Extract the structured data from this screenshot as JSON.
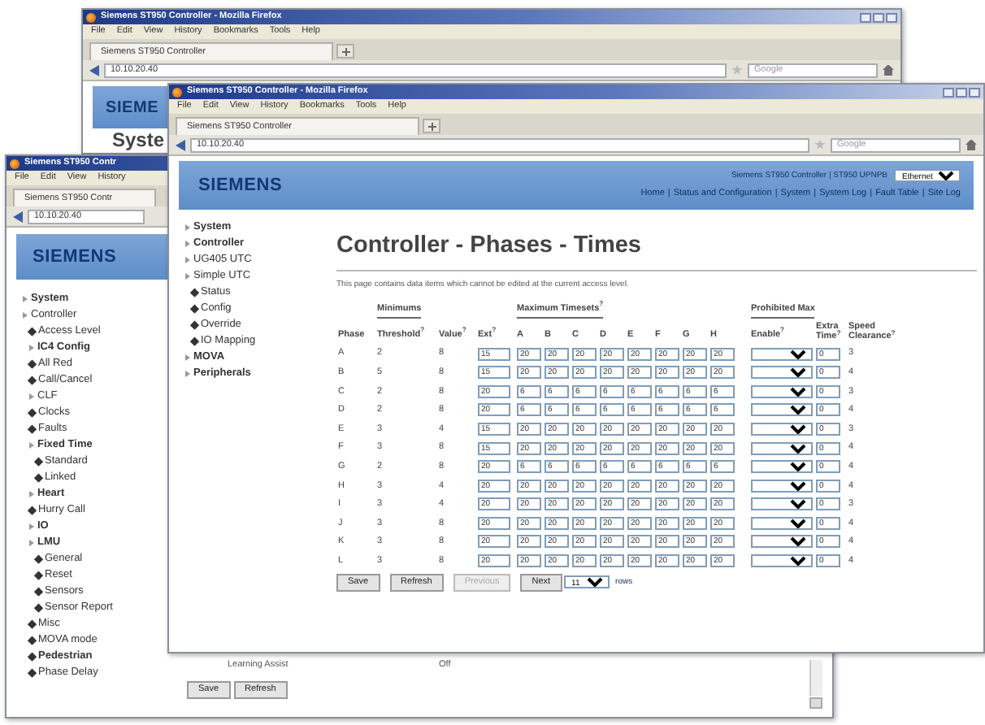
{
  "back_window": {
    "title": "Siemens ST950 Controller - Mozilla Firefox",
    "menu": [
      "File",
      "Edit",
      "View",
      "History",
      "Bookmarks",
      "Tools",
      "Help"
    ],
    "tab": "Siemens ST950 Controller",
    "address": "10.10.20.40",
    "search_placeholder": "Google",
    "logo": "SIEME",
    "heading": "Syste"
  },
  "main_window": {
    "title": "Siemens ST950 Controller - Mozilla Firefox",
    "menu": [
      "File",
      "Edit",
      "View",
      "History",
      "Bookmarks",
      "Tools",
      "Help"
    ],
    "tab": "Siemens ST950 Controller",
    "address": "10.10.20.40",
    "search_placeholder": "Google",
    "header": {
      "logo": "SIEMENS",
      "controller": "Siemens ST950 Controller | ST950 UPNPB",
      "mode_select": "Ethernet",
      "nav": [
        "Home",
        "Status and Configuration",
        "System",
        "System Log",
        "Fault Table",
        "Site Log"
      ],
      "nav_separator": "|"
    },
    "sidebar": [
      {
        "label": "System",
        "kind": "folder",
        "bold": true
      },
      {
        "label": "Controller",
        "kind": "folder",
        "bold": true
      },
      {
        "label": "UG405 UTC",
        "kind": "folder",
        "bold": false
      },
      {
        "label": "Simple UTC",
        "kind": "folder",
        "bold": false,
        "children": [
          {
            "label": "Status",
            "kind": "page",
            "bold": false
          },
          {
            "label": "Config",
            "kind": "page",
            "bold": false
          },
          {
            "label": "Override",
            "kind": "page",
            "bold": false
          },
          {
            "label": "IO Mapping",
            "kind": "page",
            "bold": false
          }
        ]
      },
      {
        "label": "MOVA",
        "kind": "folder",
        "bold": true
      },
      {
        "label": "Peripherals",
        "kind": "folder",
        "bold": true
      }
    ],
    "page": {
      "heading": "Controller - Phases - Times",
      "note": "This page contains data items which cannot be edited at the current access level.",
      "groups": {
        "minimums": "Minimums",
        "maximums": "Maximum Timesets$^{?}$",
        "prohibited": "Prohibited Max"
      },
      "columns": {
        "phase": "Phase",
        "threshold": "Threshold$^{?}$",
        "value": "Value$^{?}$",
        "ext": "Ext$^{?}$",
        "timesets": [
          "A",
          "B",
          "C",
          "D",
          "E",
          "F",
          "G",
          "H"
        ],
        "enable": "Enable$^{?}$",
        "extra_time": "Extra Time$^{?}$",
        "speed_clearance": "Speed Clearance$^{?}$"
      },
      "rows": [
        {
          "phase": "A",
          "threshold": "2",
          "value": "8",
          "ext": "15",
          "maximums": [
            "20",
            "20",
            "20",
            "20",
            "20",
            "20",
            "20",
            "20"
          ],
          "extra_time": "0",
          "speed_clearance": "3"
        },
        {
          "phase": "B",
          "threshold": "5",
          "value": "8",
          "ext": "15",
          "maximums": [
            "20",
            "20",
            "20",
            "20",
            "20",
            "20",
            "20",
            "20"
          ],
          "extra_time": "0",
          "speed_clearance": "4"
        },
        {
          "phase": "C",
          "threshold": "2",
          "value": "8",
          "ext": "20",
          "maximums": [
            "6",
            "6",
            "6",
            "6",
            "6",
            "6",
            "6",
            "6"
          ],
          "extra_time": "0",
          "speed_clearance": "3"
        },
        {
          "phase": "D",
          "threshold": "2",
          "value": "8",
          "ext": "20",
          "maximums": [
            "6",
            "6",
            "6",
            "6",
            "6",
            "6",
            "6",
            "6"
          ],
          "extra_time": "0",
          "speed_clearance": "4"
        },
        {
          "phase": "E",
          "threshold": "3",
          "value": "4",
          "ext": "15",
          "maximums": [
            "20",
            "20",
            "20",
            "20",
            "20",
            "20",
            "20",
            "20"
          ],
          "extra_time": "0",
          "speed_clearance": "3"
        },
        {
          "phase": "F",
          "threshold": "3",
          "value": "8",
          "ext": "15",
          "maximums": [
            "20",
            "20",
            "20",
            "20",
            "20",
            "20",
            "20",
            "20"
          ],
          "extra_time": "0",
          "speed_clearance": "4"
        },
        {
          "phase": "G",
          "threshold": "2",
          "value": "8",
          "ext": "20",
          "maximums": [
            "6",
            "6",
            "6",
            "6",
            "6",
            "6",
            "6",
            "6"
          ],
          "extra_time": "0",
          "speed_clearance": "4"
        },
        {
          "phase": "H",
          "threshold": "3",
          "value": "4",
          "ext": "20",
          "maximums": [
            "20",
            "20",
            "20",
            "20",
            "20",
            "20",
            "20",
            "20"
          ],
          "extra_time": "0",
          "speed_clearance": "4"
        },
        {
          "phase": "I",
          "threshold": "3",
          "value": "4",
          "ext": "20",
          "maximums": [
            "20",
            "20",
            "20",
            "20",
            "20",
            "20",
            "20",
            "20"
          ],
          "extra_time": "0",
          "speed_clearance": "3"
        },
        {
          "phase": "J",
          "threshold": "3",
          "value": "8",
          "ext": "20",
          "maximums": [
            "20",
            "20",
            "20",
            "20",
            "20",
            "20",
            "20",
            "20"
          ],
          "extra_time": "0",
          "speed_clearance": "4"
        },
        {
          "phase": "K",
          "threshold": "3",
          "value": "8",
          "ext": "20",
          "maximums": [
            "20",
            "20",
            "20",
            "20",
            "20",
            "20",
            "20",
            "20"
          ],
          "extra_time": "0",
          "speed_clearance": "4"
        },
        {
          "phase": "L",
          "threshold": "3",
          "value": "8",
          "ext": "20",
          "maximums": [
            "20",
            "20",
            "20",
            "20",
            "20",
            "20",
            "20",
            "20"
          ],
          "extra_time": "0",
          "speed_clearance": "4"
        }
      ],
      "buttons": [
        {
          "label": "Save",
          "disabled": false
        },
        {
          "label": "Refresh",
          "disabled": false
        },
        {
          "label": "Previous",
          "disabled": true
        },
        {
          "label": "Next",
          "disabled": false
        }
      ],
      "rows_select": "11",
      "rows_label": "rows"
    }
  },
  "left_window": {
    "title": "Siemens ST950 Contr",
    "menu": [
      "File",
      "Edit",
      "View",
      "History"
    ],
    "tab": "Siemens ST950 Contr",
    "address": "10.10.20.40",
    "logo": "SIEMENS",
    "sidebar": [
      {
        "label": "System",
        "kind": "folder",
        "bold": true
      },
      {
        "label": "Controller",
        "kind": "folder",
        "bold": false,
        "children": [
          {
            "label": "Access Level",
            "kind": "page",
            "bold": false
          },
          {
            "label": "IC4 Config",
            "kind": "folder",
            "bold": true
          },
          {
            "label": "All Red",
            "kind": "page",
            "bold": false
          },
          {
            "label": "Call/Cancel",
            "kind": "page",
            "bold": false
          },
          {
            "label": "CLF",
            "kind": "folder",
            "bold": false
          },
          {
            "label": "Clocks",
            "kind": "page",
            "bold": false
          },
          {
            "label": "Faults",
            "kind": "page",
            "bold": false
          },
          {
            "label": "Fixed Time",
            "kind": "folder",
            "bold": true,
            "children": [
              {
                "label": "Standard",
                "kind": "page",
                "bold": false
              },
              {
                "label": "Linked",
                "kind": "page",
                "bold": false
              }
            ]
          },
          {
            "label": "Heart",
            "kind": "folder",
            "bold": true
          },
          {
            "label": "Hurry Call",
            "kind": "page",
            "bold": false
          },
          {
            "label": "IO",
            "kind": "folder",
            "bold": true
          },
          {
            "label": "LMU",
            "kind": "folder",
            "bold": true,
            "children": [
              {
                "label": "General",
                "kind": "page",
                "bold": false
              },
              {
                "label": "Reset",
                "kind": "page",
                "bold": false
              },
              {
                "label": "Sensors",
                "kind": "page",
                "bold": false
              },
              {
                "label": "Sensor Report",
                "kind": "page",
                "bold": false
              }
            ]
          },
          {
            "label": "Misc",
            "kind": "page",
            "bold": false
          },
          {
            "label": "MOVA mode",
            "kind": "page",
            "bold": false
          },
          {
            "label": "Pedestrian",
            "kind": "page",
            "bold": true
          },
          {
            "label": "Phase Delay",
            "kind": "page",
            "bold": false
          }
        ]
      }
    ],
    "setting": {
      "label": "Learning Assist",
      "value": "Off"
    },
    "buttons": [
      {
        "label": "Save",
        "disabled": false
      },
      {
        "label": "Refresh",
        "disabled": false
      }
    ]
  }
}
